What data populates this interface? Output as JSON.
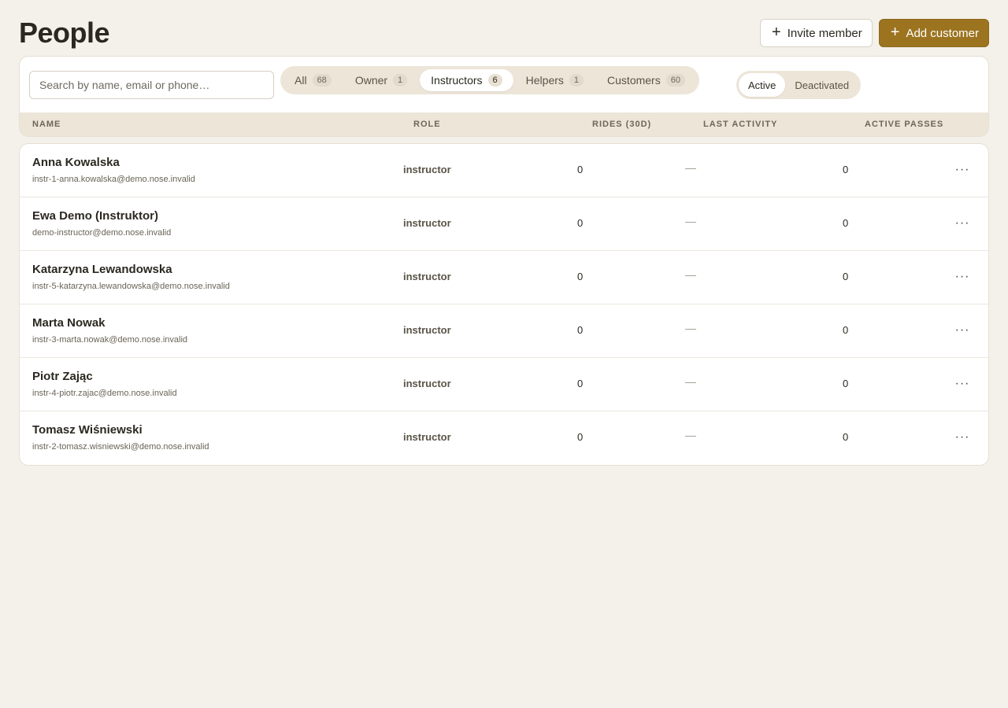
{
  "header": {
    "title": "People",
    "invite_label": "Invite member",
    "add_label": "Add customer",
    "plus_icon": "+"
  },
  "filters": {
    "search_placeholder": "Search by name, email or phone…",
    "role_tabs": [
      {
        "label": "All",
        "count": "68",
        "selected": false
      },
      {
        "label": "Owner",
        "count": "1",
        "selected": false
      },
      {
        "label": "Instructors",
        "count": "6",
        "selected": true
      },
      {
        "label": "Helpers",
        "count": "1",
        "selected": false
      },
      {
        "label": "Customers",
        "count": "60",
        "selected": false
      }
    ],
    "status": [
      {
        "label": "Active",
        "selected": true
      },
      {
        "label": "Deactivated",
        "selected": false
      }
    ]
  },
  "table": {
    "columns": {
      "name": "NAME",
      "role": "ROLE",
      "rides": "RIDES (30D)",
      "last_activity": "LAST ACTIVITY",
      "active_passes": "ACTIVE PASSES"
    },
    "menu_glyph": "···",
    "rows": [
      {
        "name": "Anna Kowalska",
        "email": "instr-1-anna.kowalska@demo.nose.invalid",
        "role": "instructor",
        "rides": "0",
        "last_activity": "—",
        "active_passes": "0"
      },
      {
        "name": "Ewa Demo (Instruktor)",
        "email": "demo-instructor@demo.nose.invalid",
        "role": "instructor",
        "rides": "0",
        "last_activity": "—",
        "active_passes": "0"
      },
      {
        "name": "Katarzyna Lewandowska",
        "email": "instr-5-katarzyna.lewandowska@demo.nose.invalid",
        "role": "instructor",
        "rides": "0",
        "last_activity": "—",
        "active_passes": "0"
      },
      {
        "name": "Marta Nowak",
        "email": "instr-3-marta.nowak@demo.nose.invalid",
        "role": "instructor",
        "rides": "0",
        "last_activity": "—",
        "active_passes": "0"
      },
      {
        "name": "Piotr Zając",
        "email": "instr-4-piotr.zajac@demo.nose.invalid",
        "role": "instructor",
        "rides": "0",
        "last_activity": "—",
        "active_passes": "0"
      },
      {
        "name": "Tomasz Wiśniewski",
        "email": "instr-2-tomasz.wisniewski@demo.nose.invalid",
        "role": "instructor",
        "rides": "0",
        "last_activity": "—",
        "active_passes": "0"
      }
    ]
  },
  "colors": {
    "background": "#f4f1eb",
    "accent": "#9c7420",
    "tab_track": "#ece5d8"
  }
}
